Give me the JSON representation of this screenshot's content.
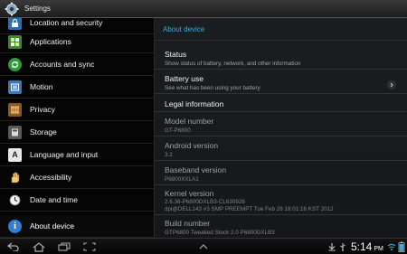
{
  "window": {
    "title": "Settings",
    "icon": "gear-icon"
  },
  "sidebar": {
    "items": [
      {
        "label": "Location and security",
        "icon": "location-security-icon"
      },
      {
        "label": "Applications",
        "icon": "applications-icon"
      },
      {
        "label": "Accounts and sync",
        "icon": "sync-icon"
      },
      {
        "label": "Motion",
        "icon": "motion-icon"
      },
      {
        "label": "Privacy",
        "icon": "privacy-icon"
      },
      {
        "label": "Storage",
        "icon": "storage-icon"
      },
      {
        "label": "Language and input",
        "icon": "language-icon"
      },
      {
        "label": "Accessibility",
        "icon": "accessibility-hand-icon"
      },
      {
        "label": "Date and time",
        "icon": "clock-icon"
      },
      {
        "label": "About device",
        "icon": "info-icon",
        "selected": true
      }
    ]
  },
  "content": {
    "header": "About device",
    "status": {
      "title": "Status",
      "subtitle": "Show status of battery, network, and other information"
    },
    "battery": {
      "title": "Battery use",
      "subtitle": "See what has been using your battery"
    },
    "legal": {
      "title": "Legal information"
    },
    "model": {
      "title": "Model number",
      "value": "GT-P6800"
    },
    "android": {
      "title": "Android version",
      "value": "3.2"
    },
    "baseband": {
      "title": "Baseband version",
      "value": "P6800XXLA1"
    },
    "kernel": {
      "title": "Kernel version",
      "value": "2.6.36-P6800DXLB3-CL630926",
      "value2": "dpi@DELL143 #3 SMP PREEMPT Tue Feb 28 18:01:16 KST 2012"
    },
    "build": {
      "title": "Build number",
      "value": "GTP6800 Tweaked Stock 2.0 P6800DXLB3"
    }
  },
  "navbar": {
    "clock": "5:14",
    "clock_suffix": "PM"
  },
  "colors": {
    "accent": "#3fa9de",
    "content_bg": "#1b1e20",
    "sidebar_bg": "#050505"
  }
}
